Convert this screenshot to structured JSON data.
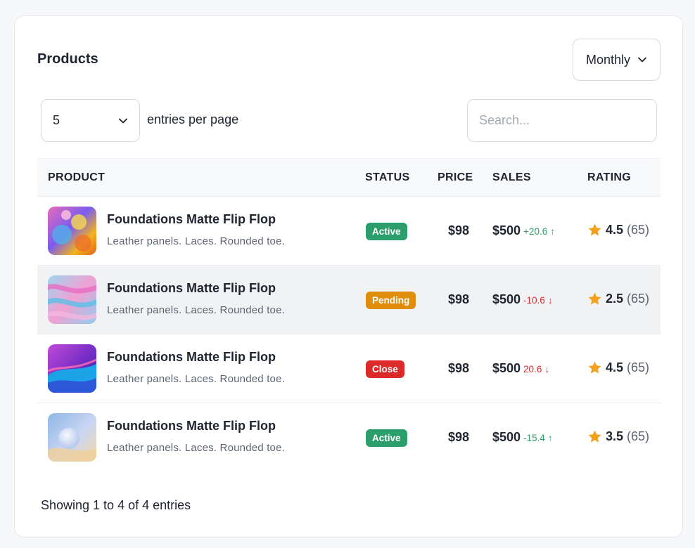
{
  "header": {
    "title": "Products",
    "period": "Monthly"
  },
  "controls": {
    "per_page_value": "5",
    "per_page_label": "entries per page",
    "search_placeholder": "Search..."
  },
  "table": {
    "columns": [
      "PRODUCT",
      "STATUS",
      "PRICE",
      "SALES",
      "RATING"
    ],
    "rows": [
      {
        "name": "Foundations Matte Flip Flop",
        "desc": "Leather panels. Laces. Rounded toe.",
        "status": "Active",
        "price": "$98",
        "sales": "$500",
        "trend": "+20.6",
        "trend_dir": "up",
        "rating": "4.5",
        "reviews": "(65)"
      },
      {
        "name": "Foundations Matte Flip Flop",
        "desc": "Leather panels. Laces. Rounded toe.",
        "status": "Pending",
        "price": "$98",
        "sales": "$500",
        "trend": "-10.6",
        "trend_dir": "down",
        "rating": "2.5",
        "reviews": "(65)"
      },
      {
        "name": "Foundations Matte Flip Flop",
        "desc": "Leather panels. Laces. Rounded toe.",
        "status": "Close",
        "price": "$98",
        "sales": "$500",
        "trend": "20.6",
        "trend_dir": "down",
        "rating": "4.5",
        "reviews": "(65)"
      },
      {
        "name": "Foundations Matte Flip Flop",
        "desc": "Leather panels. Laces. Rounded toe.",
        "status": "Active",
        "price": "$98",
        "sales": "$500",
        "trend": "-15.4",
        "trend_dir": "up",
        "rating": "3.5",
        "reviews": "(65)"
      }
    ]
  },
  "footer": {
    "summary": "Showing 1 to 4 of 4 entries"
  },
  "colors": {
    "active": "#2b9e6b",
    "pending": "#e08d0c",
    "close": "#dc2a2a",
    "trend_up": "#2b9e6b",
    "trend_down": "#dc2a2a",
    "star": "#f5a01a"
  },
  "icons": {
    "period_dropdown": "chevron-down-icon",
    "per_page_dropdown": "chevron-down-icon",
    "rating": "star-icon",
    "trend_up": "arrow-up-icon",
    "trend_down": "arrow-down-icon"
  }
}
